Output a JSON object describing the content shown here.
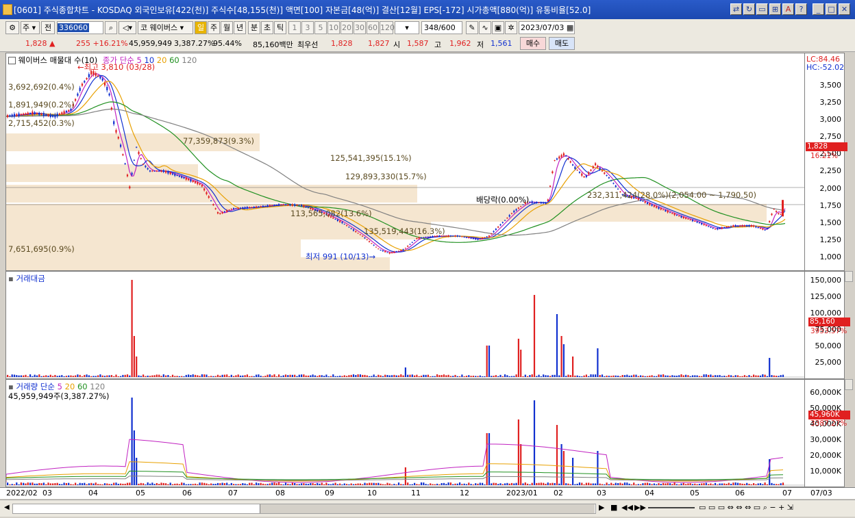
{
  "window": {
    "title": "[0601] 주식종합차트 - KOSDAQ 외국인보유[422(천)] 주식수[48,155(천)] 액면[100] 자본금[48(억)] 결산[12월] EPS[-172] 시가총액[880(억)] 유통비율[52.0]"
  },
  "toolbar": {
    "market": "주",
    "prev": "전",
    "code": "336060",
    "name_label": "코",
    "stock_name": "웨이버스",
    "periods": [
      "일",
      "주",
      "월",
      "년",
      "분",
      "초",
      "틱"
    ],
    "intervals": [
      "1",
      "3",
      "5",
      "10",
      "20",
      "30",
      "60",
      "120"
    ],
    "count": "348",
    "count_max": "/600",
    "date": "2023/07/03"
  },
  "quote": {
    "price": "1,828",
    "arrow": "▲",
    "change": "255",
    "rate": "+16.21%",
    "volume": "45,959,949",
    "vol_rate": "3,387.27%",
    "pct": "95.44%",
    "amount": "85,160백만",
    "best_label": "최우선",
    "ask": "1,828",
    "bid": "1,827",
    "open_label": "시",
    "open": "1,587",
    "high_label": "고",
    "high": "1,962",
    "low_label": "저",
    "low": "1,561",
    "buy": "매수",
    "sell": "매도"
  },
  "price_pane": {
    "legend": {
      "name": "웨이버스 매물대 수(10)",
      "ma_label": "종가 단순",
      "ma": [
        "5",
        "10",
        "20",
        "60",
        "120"
      ]
    },
    "lc": "LC:84.46",
    "hc": "HC:-52.02",
    "y_ticks": [
      "3,500",
      "3,250",
      "3,000",
      "2,750",
      "2,500",
      "2,250",
      "2,000",
      "1,750",
      "1,500",
      "1,250",
      "1,000"
    ],
    "annotations": {
      "high": "최고 3,810 (03/28)",
      "low": "최저 991 (10/13)",
      "dividend": "배당락(0.00%)"
    },
    "profile": [
      "3,692,692(0.4%)",
      "1,891,949(0.2%)",
      "2,715,452(0.3%)",
      "77,359,873(9.3%)",
      "125,541,395(15.1%)",
      "129,893,330(15.7%)",
      "232,311,424(28.0%)(2,054.00 ~ 1,790.50)",
      "113,565,082(13.6%)",
      "135,519,443(16.3%)",
      "7,651,695(0.9%)"
    ],
    "price_tag": "1,828",
    "rate_tag": "16.21%"
  },
  "amount_pane": {
    "legend": "거래대금",
    "y_ticks": [
      "150,000",
      "125,000",
      "100,000",
      "75,000",
      "50,000",
      "25,000"
    ],
    "tag": "85,160",
    "sub": "3953.57%"
  },
  "volume_pane": {
    "legend": "거래량 단순",
    "ma": [
      "5",
      "20",
      "60",
      "120"
    ],
    "info": "45,959,949주(3,387.27%)",
    "y_ticks": [
      "60,000K",
      "50,000K",
      "40,000K",
      "30,000K",
      "20,000K",
      "10,000K"
    ],
    "tag": "45,960K",
    "sub": "3387.27%"
  },
  "x_axis": [
    "2022/02",
    "03",
    "04",
    "05",
    "06",
    "07",
    "08",
    "09",
    "10",
    "11",
    "12",
    "2023/01",
    "02",
    "03",
    "04",
    "05",
    "06",
    "07",
    "07/03"
  ],
  "colors": {
    "up": "#e02020",
    "down": "#1030d0",
    "ma5": "#c020c0",
    "ma10": "#1030d0",
    "ma20": "#e8a000",
    "ma60": "#209020",
    "ma120": "#808080",
    "profile": "#f5e6d0"
  }
}
